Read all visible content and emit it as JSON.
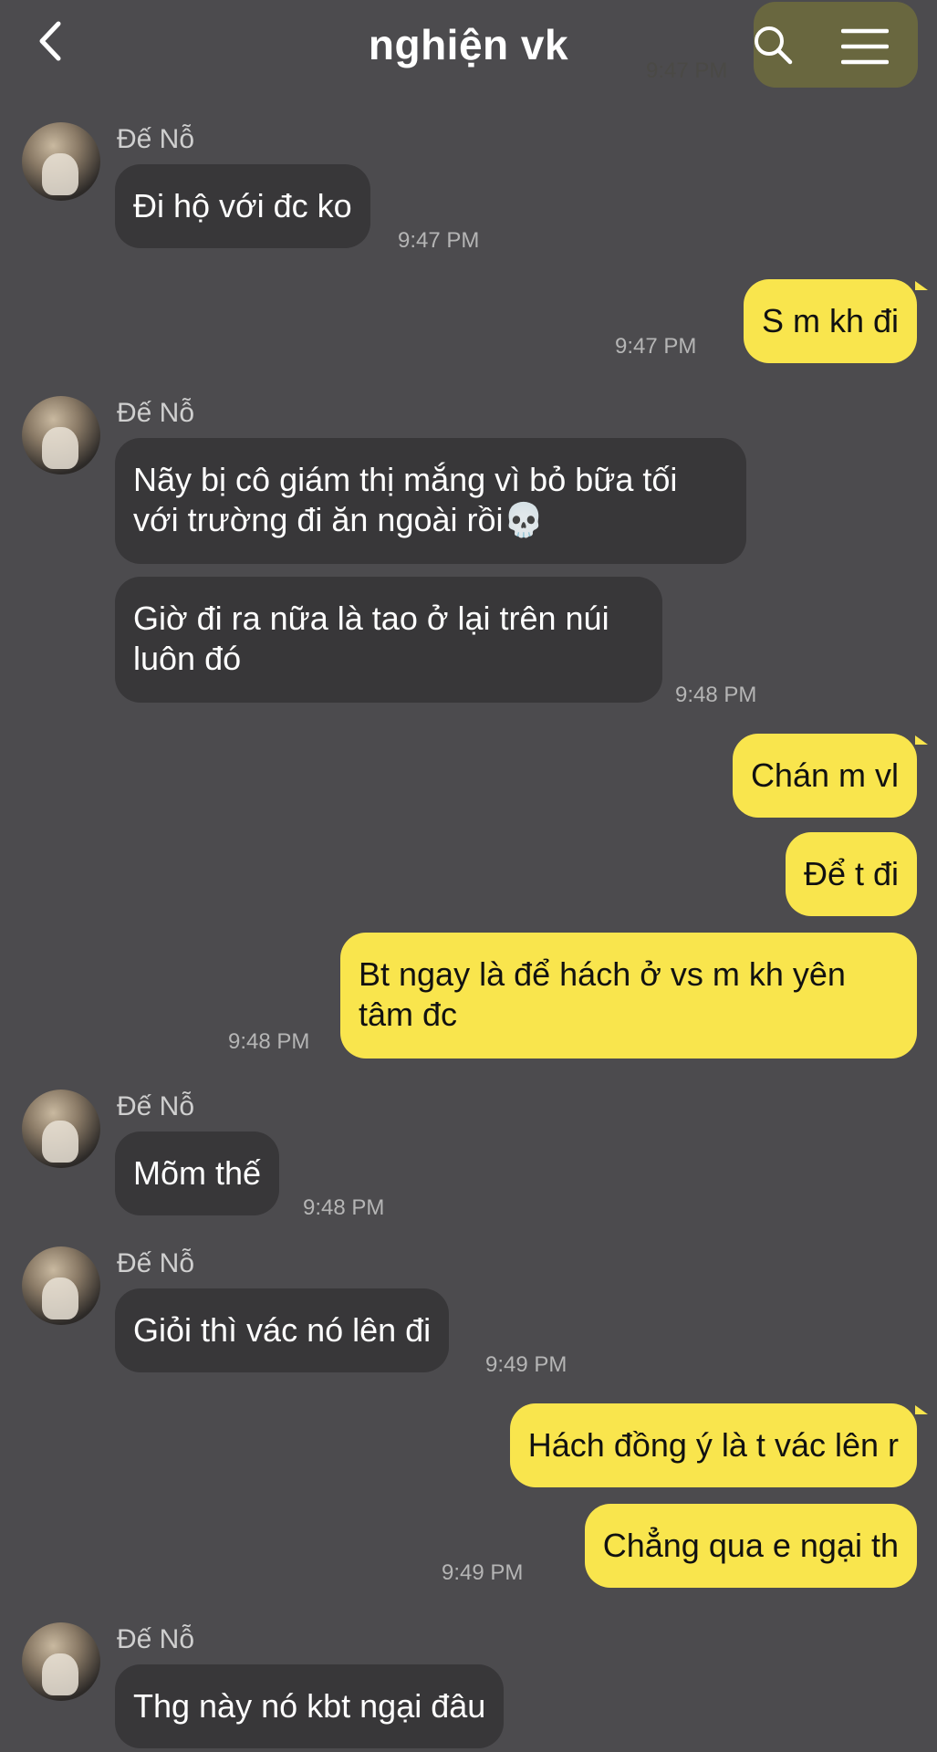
{
  "header": {
    "title": "nghiện vk",
    "ghost_time": "9:47 PM"
  },
  "messages": [
    {
      "id": 1,
      "side": "in",
      "sender": "Đế Nỗ",
      "text": "Đi hộ với đc ko",
      "time": "9:47 PM"
    },
    {
      "id": 2,
      "side": "out",
      "text": "S m kh đi",
      "time": "9:47 PM"
    },
    {
      "id": 3,
      "side": "in",
      "sender": "Đế Nỗ",
      "lines": [
        "Nãy bị cô giám thị mắng vì bỏ bữa tối",
        "với trường đi ăn ngoài rồi💀"
      ]
    },
    {
      "id": 4,
      "side": "in",
      "lines": [
        "Giờ đi ra nữa là tao ở lại trên núi",
        "luôn đó"
      ],
      "time": "9:48 PM"
    },
    {
      "id": 5,
      "side": "out",
      "text": "Chán m vl"
    },
    {
      "id": 6,
      "side": "out",
      "text": "Để t đi"
    },
    {
      "id": 7,
      "side": "out",
      "lines": [
        "Bt ngay là để hách ở vs m kh yên",
        "tâm đc"
      ],
      "time": "9:48 PM"
    },
    {
      "id": 8,
      "side": "in",
      "sender": "Đế Nỗ",
      "text": "Mõm thế",
      "time": "9:48 PM"
    },
    {
      "id": 9,
      "side": "in",
      "sender": "Đế Nỗ",
      "text": "Giỏi thì vác nó lên đi",
      "time": "9:49 PM"
    },
    {
      "id": 10,
      "side": "out",
      "text": "Hách đồng ý là t vác lên r"
    },
    {
      "id": 11,
      "side": "out",
      "text": "Chẳng qua e ngại th",
      "time": "9:49 PM"
    },
    {
      "id": 12,
      "side": "in",
      "sender": "Đế Nỗ",
      "text": "Thg này nó kbt ngại đâu"
    }
  ],
  "colors": {
    "background": "#4c4b4e",
    "incoming_bubble": "#383739",
    "outgoing_bubble": "#f9e54d"
  },
  "icons": [
    "back-arrow-icon",
    "search-icon",
    "menu-icon",
    "skull-emoji"
  ]
}
